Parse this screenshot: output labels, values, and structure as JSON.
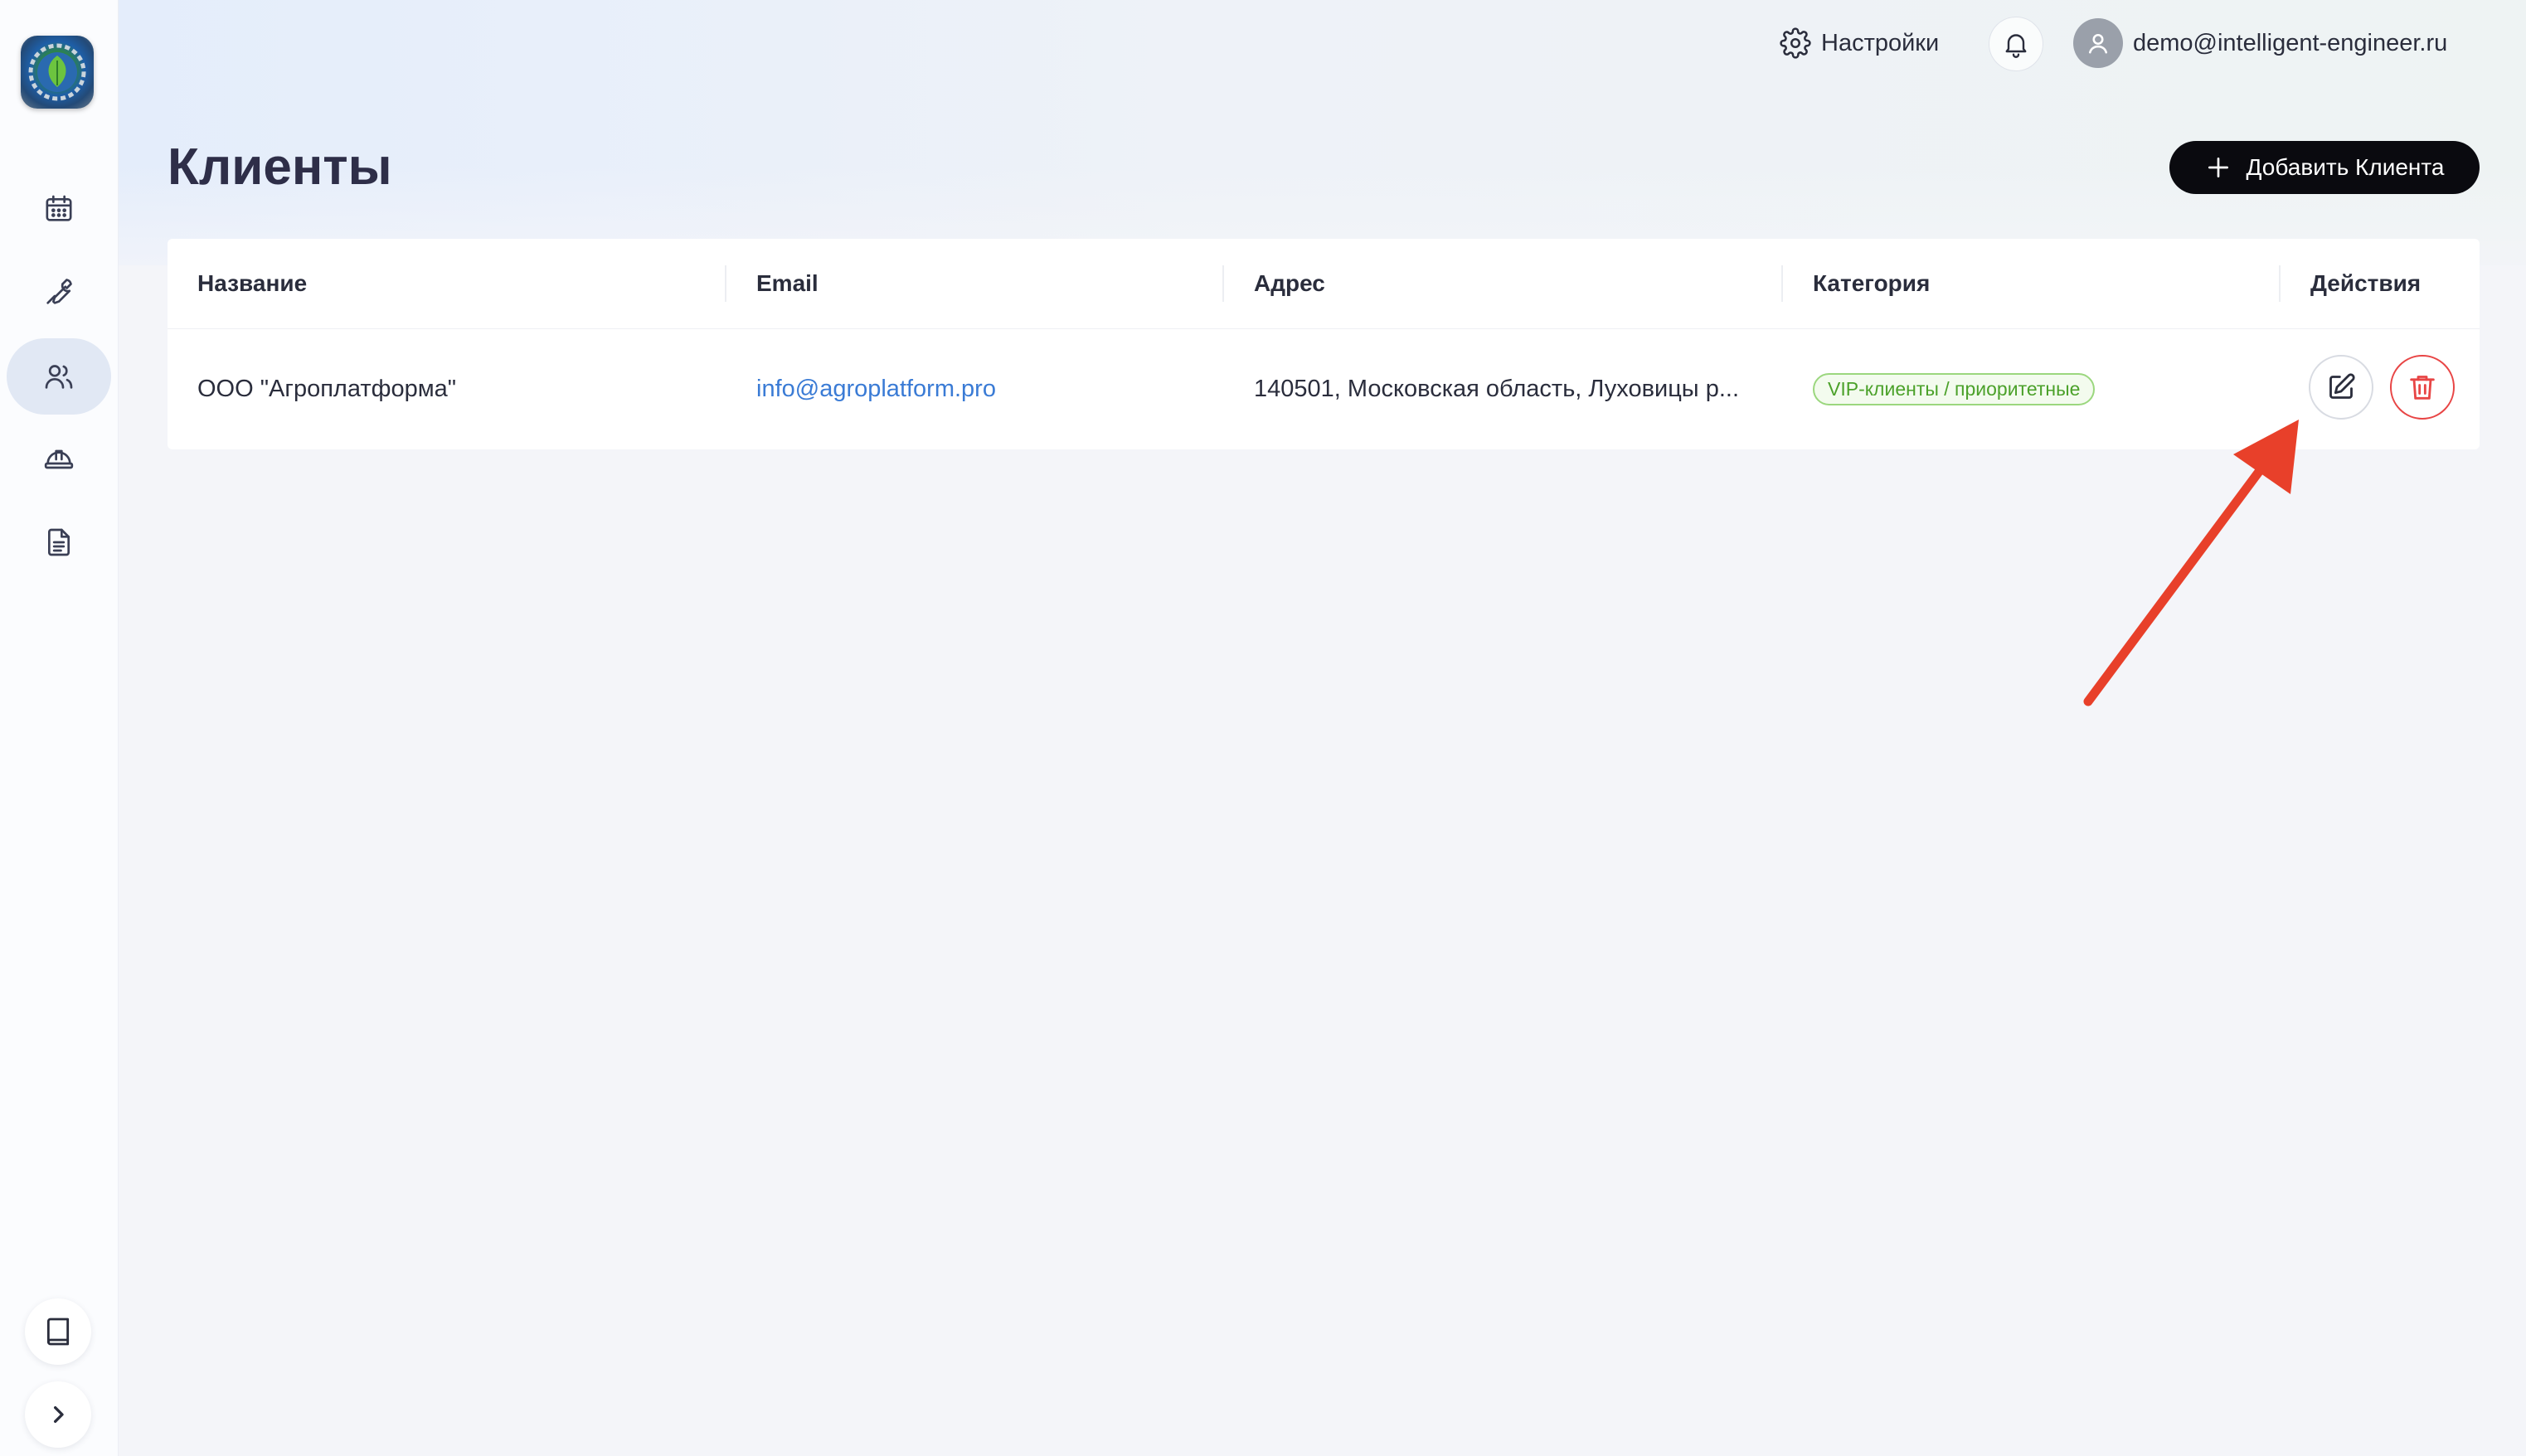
{
  "header": {
    "settings_label": "Настройки",
    "user_email": "demo@intelligent-engineer.ru"
  },
  "page": {
    "title": "Клиенты",
    "add_button_label": "Добавить Клиента"
  },
  "sidebar": {
    "items": [
      {
        "icon": "calendar-icon",
        "active": false
      },
      {
        "icon": "wrench-icon",
        "active": false
      },
      {
        "icon": "users-icon",
        "active": true
      },
      {
        "icon": "hardhat-icon",
        "active": false
      },
      {
        "icon": "document-icon",
        "active": false
      }
    ],
    "bottom": [
      {
        "icon": "book-icon"
      },
      {
        "icon": "chevron-right-icon"
      }
    ]
  },
  "table": {
    "columns": [
      "Название",
      "Email",
      "Адрес",
      "Категория",
      "Действия"
    ],
    "rows": [
      {
        "name": "ООО \"Агроплатформа\"",
        "email": "info@agroplatform.pro",
        "address": "140501, Московская область, Луховицы р...",
        "category": "VIP-клиенты / приоритетные"
      }
    ]
  },
  "colors": {
    "accent_dark": "#0a0a0f",
    "link": "#3a7bd5",
    "badge_green": "#4ba12a",
    "delete_red": "#e84545",
    "annotation_arrow": "#e8402a"
  }
}
